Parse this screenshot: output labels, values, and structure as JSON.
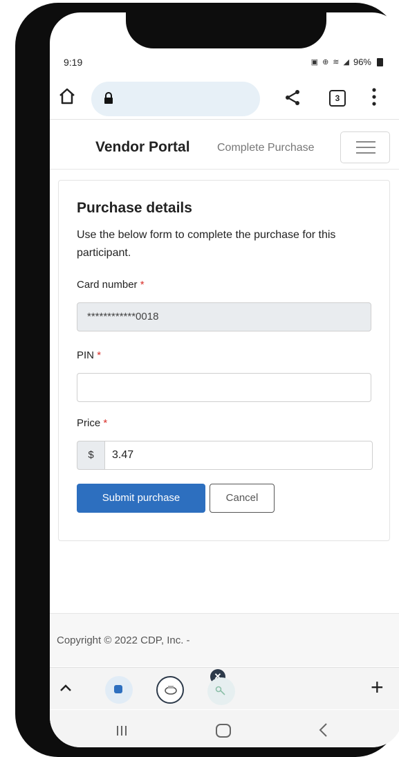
{
  "status_bar": {
    "time": "9:19",
    "battery": "96%"
  },
  "browser": {
    "tab_count": "3"
  },
  "nav": {
    "brand": "Vendor Portal",
    "link": "Complete Purchase"
  },
  "form": {
    "title": "Purchase details",
    "description": "Use the below form to complete the purchase for this participant.",
    "card_number_label": "Card number",
    "card_number_value": "************0018",
    "pin_label": "PIN",
    "pin_value": "",
    "price_label": "Price",
    "price_prefix": "$",
    "price_value": "3.47",
    "required_mark": "*",
    "submit_label": "Submit purchase",
    "cancel_label": "Cancel"
  },
  "footer": {
    "copyright": "Copyright © 2022 CDP, Inc. -"
  },
  "bottom_bar": {
    "close_badge": "✕",
    "plus": "+"
  },
  "colors": {
    "primary": "#2d6fbf",
    "required": "#d9302a",
    "url_pill": "#e7f0f7"
  }
}
